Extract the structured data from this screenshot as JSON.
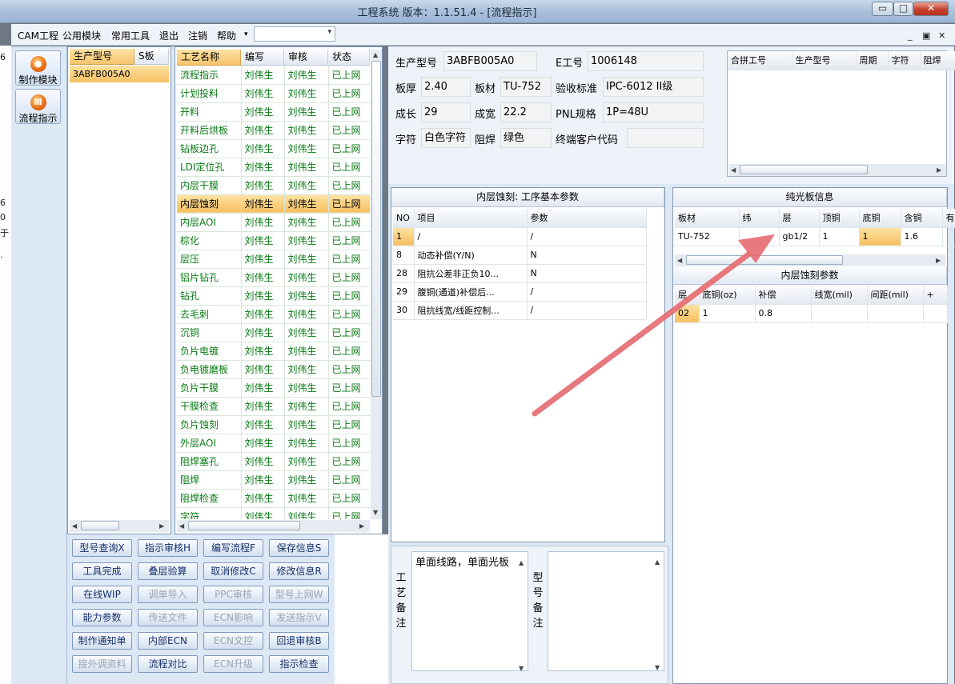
{
  "window": {
    "title": "工程系统   版本：1.1.51.4 - [流程指示]",
    "minimize": "▭",
    "restore": "□",
    "close": "✕"
  },
  "menu": {
    "items": [
      "CAM工程",
      "公用模块",
      "常用工具",
      "退出",
      "注销",
      "帮助"
    ],
    "overflow": "▾",
    "combo_arrow": "▾",
    "mdi_min": "_",
    "mdi_restore": "▣",
    "mdi_close": "✕"
  },
  "left_edge": [
    "6",
    "6",
    "0",
    "于",
    "·"
  ],
  "toolbar": [
    {
      "label": "制作模块",
      "icon": "gear-icon"
    },
    {
      "label": "流程指示",
      "icon": "flow-icon"
    }
  ],
  "model_list": {
    "headers": [
      "生产型号",
      "S板"
    ],
    "rows": [
      [
        "3ABFB005A0",
        ""
      ]
    ]
  },
  "process_list": {
    "headers": [
      "工艺名称",
      "编写",
      "审核",
      "状态"
    ],
    "rows": [
      [
        "流程指示",
        "刘伟生",
        "刘伟生",
        "已上网"
      ],
      [
        "计划投料",
        "刘伟生",
        "刘伟生",
        "已上网"
      ],
      [
        "开料",
        "刘伟生",
        "刘伟生",
        "已上网"
      ],
      [
        "开料后烘板",
        "刘伟生",
        "刘伟生",
        "已上网"
      ],
      [
        "钻板边孔",
        "刘伟生",
        "刘伟生",
        "已上网"
      ],
      [
        "LDI定位孔",
        "刘伟生",
        "刘伟生",
        "已上网"
      ],
      [
        "内层干膜",
        "刘伟生",
        "刘伟生",
        "已上网"
      ],
      [
        "内层蚀刻",
        "刘伟生",
        "刘伟生",
        "已上网"
      ],
      [
        "内层AOI",
        "刘伟生",
        "刘伟生",
        "已上网"
      ],
      [
        "棕化",
        "刘伟生",
        "刘伟生",
        "已上网"
      ],
      [
        "层压",
        "刘伟生",
        "刘伟生",
        "已上网"
      ],
      [
        "铝片钻孔",
        "刘伟生",
        "刘伟生",
        "已上网"
      ],
      [
        "钻孔",
        "刘伟生",
        "刘伟生",
        "已上网"
      ],
      [
        "去毛刺",
        "刘伟生",
        "刘伟生",
        "已上网"
      ],
      [
        "沉铜",
        "刘伟生",
        "刘伟生",
        "已上网"
      ],
      [
        "负片电镀",
        "刘伟生",
        "刘伟生",
        "已上网"
      ],
      [
        "负电镀磨板",
        "刘伟生",
        "刘伟生",
        "已上网"
      ],
      [
        "负片干膜",
        "刘伟生",
        "刘伟生",
        "已上网"
      ],
      [
        "干膜检查",
        "刘伟生",
        "刘伟生",
        "已上网"
      ],
      [
        "负片蚀刻",
        "刘伟生",
        "刘伟生",
        "已上网"
      ],
      [
        "外层AOI",
        "刘伟生",
        "刘伟生",
        "已上网"
      ],
      [
        "阻焊塞孔",
        "刘伟生",
        "刘伟生",
        "已上网"
      ],
      [
        "阻焊",
        "刘伟生",
        "刘伟生",
        "已上网"
      ],
      [
        "阻焊检查",
        "刘伟生",
        "刘伟生",
        "已上网"
      ],
      [
        "字符",
        "刘伟生",
        "刘伟生",
        "已上网"
      ]
    ],
    "selected_index": 7
  },
  "info": {
    "prod_model_label": "生产型号",
    "prod_model": "3ABFB005A0",
    "e_no_label": "E工号",
    "e_no": "1006148",
    "thickness_label": "板厚",
    "thickness": "2.40",
    "material_label": "板材",
    "material": "TU-752",
    "standard_label": "验收标准",
    "standard": "IPC-6012 II级",
    "length_label": "成长",
    "length": "29",
    "width_label": "成宽",
    "width": "22.2",
    "pnl_label": "PNL规格",
    "pnl": "1P=48U",
    "char_label": "字符",
    "char": "白色字符",
    "mask_label": "阻焊",
    "mask": "绿色",
    "cust_label": "终端客户代码",
    "cust": ""
  },
  "merge_grid": {
    "headers": [
      "合拼工号",
      "生产型号",
      "周期",
      "字符",
      "阻焊"
    ]
  },
  "inner_etch": {
    "title": "内层蚀刻: 工序基本参数",
    "headers": [
      "NO",
      "项目",
      "参数"
    ],
    "rows": [
      [
        "1",
        "/",
        "/"
      ],
      [
        "8",
        "动态补偿(Y/N)",
        "N"
      ],
      [
        "28",
        "阻抗公差非正负10...",
        "N"
      ],
      [
        "29",
        "腹铜(通道)补偿后...",
        "/"
      ],
      [
        "30",
        "阻抗线宽/线距控制...",
        "/"
      ]
    ]
  },
  "plain_board": {
    "title": "纯光板信息",
    "headers": [
      "板材",
      "纬",
      "层",
      "顶铜",
      "底铜",
      "含铜"
    ],
    "rows": [
      [
        "TU-752",
        "",
        "gb1/2",
        "1",
        "1",
        "1.6"
      ]
    ],
    "extra_header": "有"
  },
  "etch_params": {
    "title": "内层蚀刻参数",
    "headers": [
      "层",
      "底铜(oz)",
      "补偿",
      "线宽(mil)",
      "间距(mil)",
      "+"
    ],
    "rows": [
      [
        "02",
        "1",
        "0.8",
        "",
        ""
      ]
    ]
  },
  "buttons": [
    {
      "label": "型号查询X",
      "enabled": true
    },
    {
      "label": "指示审核H",
      "enabled": true
    },
    {
      "label": "编写流程F",
      "enabled": true
    },
    {
      "label": "保存信息S",
      "enabled": true
    },
    {
      "label": "工具完成",
      "enabled": true
    },
    {
      "label": "叠层验算",
      "enabled": true
    },
    {
      "label": "取消修改C",
      "enabled": true
    },
    {
      "label": "修改信息R",
      "enabled": true
    },
    {
      "label": "在线WIP",
      "enabled": true
    },
    {
      "label": "调单导入",
      "enabled": false
    },
    {
      "label": "PPC审核",
      "enabled": false
    },
    {
      "label": "型号上网W",
      "enabled": false
    },
    {
      "label": "能力参数",
      "enabled": true
    },
    {
      "label": "传送文件",
      "enabled": false
    },
    {
      "label": "ECN影响",
      "enabled": false
    },
    {
      "label": "发送指示V",
      "enabled": false
    },
    {
      "label": "制作通知单",
      "enabled": true
    },
    {
      "label": "内部ECN",
      "enabled": true
    },
    {
      "label": "ECN文控",
      "enabled": false
    },
    {
      "label": "回退审核B",
      "enabled": true
    },
    {
      "label": "接外调资料",
      "enabled": false
    },
    {
      "label": "流程对比",
      "enabled": true
    },
    {
      "label": "ECN升级",
      "enabled": false
    },
    {
      "label": "指示检查",
      "enabled": true
    }
  ],
  "remarks": {
    "process_label": "工艺备注",
    "process_text": "单面线路，单面光板",
    "model_label": "型号备注",
    "model_text": ""
  },
  "colors": {
    "accent": "#f6c36c",
    "green_text": "#0b7a16",
    "annotation_arrow": "#e56a70"
  }
}
